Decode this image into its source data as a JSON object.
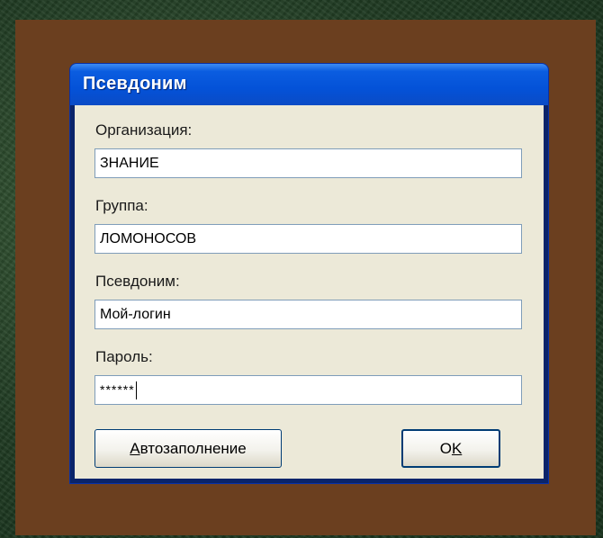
{
  "dialog": {
    "title": "Псевдоним",
    "organization": {
      "label": "Организация:",
      "value": "ЗНАНИЕ"
    },
    "group": {
      "label": "Группа:",
      "value": "ЛОМОНОСОВ"
    },
    "alias": {
      "label": "Псевдоним:",
      "value": "Мой-логин"
    },
    "password": {
      "label": "Пароль:",
      "value": "******"
    },
    "autofill_button": {
      "first_letter": "А",
      "rest": "втозаполнение"
    },
    "ok_button": {
      "first_letter": "O",
      "rest": "K"
    }
  }
}
